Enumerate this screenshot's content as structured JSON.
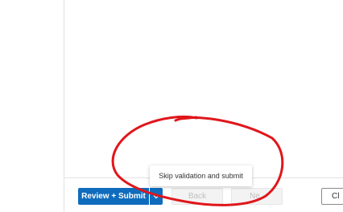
{
  "footer": {
    "primary_label": "Review + Submit",
    "split_icon": "chevron-down-icon",
    "back_label": "Back",
    "next_label": "Ne",
    "close_label": "Cl"
  },
  "tooltip": {
    "text": "Skip validation and submit"
  },
  "colors": {
    "primary": "#0f6cbd",
    "annotation": "#e0161b"
  }
}
